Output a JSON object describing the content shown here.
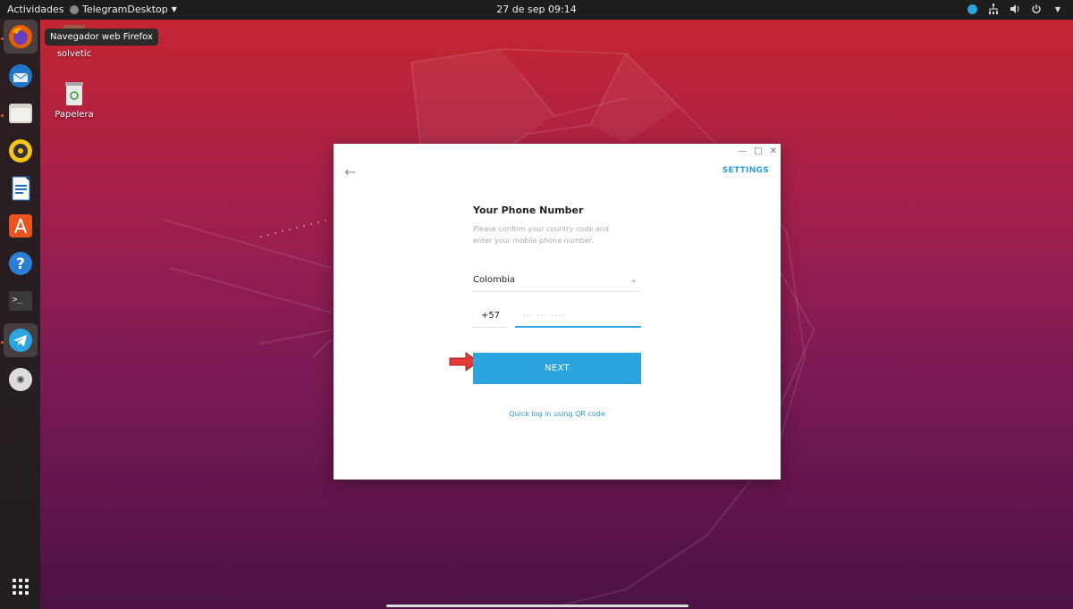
{
  "topbar": {
    "activities": "Actividades",
    "app_name": "TelegramDesktop",
    "clock": "27 de sep  09:14"
  },
  "dock": {
    "tooltip": "Navegador web Firefox",
    "items": [
      "firefox",
      "thunderbird",
      "files",
      "rhythmbox",
      "libreoffice-writer",
      "software",
      "help",
      "terminal",
      "telegram",
      "dvd"
    ]
  },
  "desktop": {
    "icons": [
      {
        "label": "solvetic"
      },
      {
        "label": "Papelera"
      }
    ]
  },
  "window": {
    "settings": "SETTINGS",
    "title": "Your Phone Number",
    "description": "Please confirm your country code and enter your mobile phone number.",
    "country": "Colombia",
    "country_code": "+57",
    "phone_placeholder": "--- --- ----",
    "next_label": "NEXT",
    "qr_link": "Quick log in using QR code"
  },
  "colors": {
    "accent": "#2aa5e0",
    "ubuntu_orange": "#e95420"
  }
}
